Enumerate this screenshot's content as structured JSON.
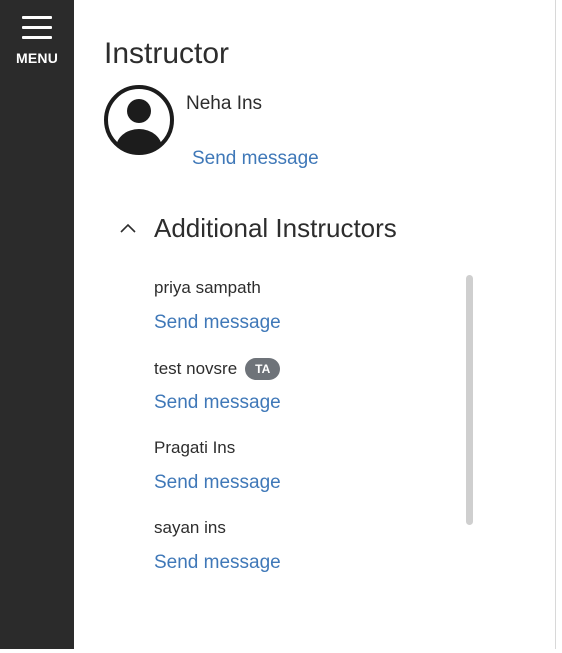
{
  "sidebar": {
    "menu_label": "MENU"
  },
  "main": {
    "title": "Instructor",
    "primary_instructor": {
      "name": "Neha Ins",
      "send_message": "Send message"
    },
    "additional": {
      "title": "Additional Instructors",
      "items": [
        {
          "name": "priya sampath",
          "send_message": "Send message",
          "badge": ""
        },
        {
          "name": "test novsre",
          "send_message": "Send message",
          "badge": "TA"
        },
        {
          "name": "Pragati Ins",
          "send_message": "Send message",
          "badge": ""
        },
        {
          "name": "sayan ins",
          "send_message": "Send message",
          "badge": ""
        }
      ]
    }
  },
  "colors": {
    "sidebar_bg": "#2b2b2b",
    "link": "#3f78b8",
    "badge_bg": "#6e7379",
    "text": "#2d2d2d"
  },
  "icons": {
    "menu": "hamburger-icon",
    "avatar": "user-avatar-icon",
    "collapse": "chevron-up-icon"
  }
}
